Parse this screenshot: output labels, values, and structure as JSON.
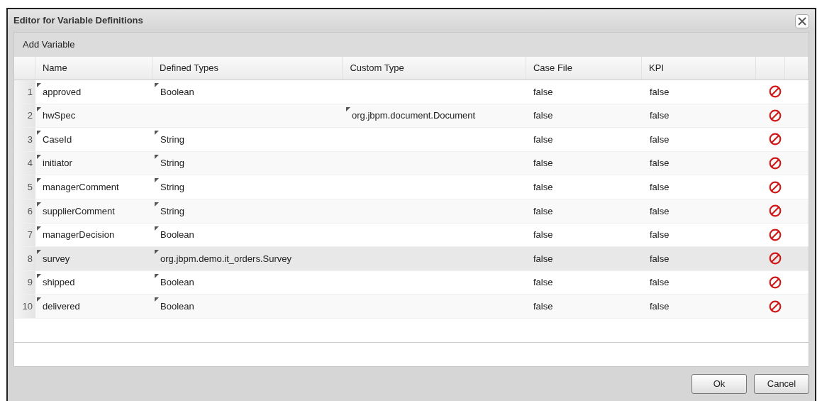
{
  "dialog": {
    "title": "Editor for Variable Definitions"
  },
  "toolbar": {
    "add_button": "Add Variable"
  },
  "table": {
    "columns": [
      "Name",
      "Defined Types",
      "Custom Type",
      "Case File",
      "KPI"
    ],
    "rows": [
      {
        "number": "1",
        "name": "approved",
        "defined_type": "Boolean",
        "custom_type": "",
        "case_file": "false",
        "kpi": "false",
        "selected": false
      },
      {
        "number": "2",
        "name": "hwSpec",
        "defined_type": "",
        "custom_type": "org.jbpm.document.Document",
        "case_file": "false",
        "kpi": "false",
        "selected": false
      },
      {
        "number": "3",
        "name": "CaseId",
        "defined_type": "String",
        "custom_type": "",
        "case_file": "false",
        "kpi": "false",
        "selected": false
      },
      {
        "number": "4",
        "name": "initiator",
        "defined_type": "String",
        "custom_type": "",
        "case_file": "false",
        "kpi": "false",
        "selected": false
      },
      {
        "number": "5",
        "name": "managerComment",
        "defined_type": "String",
        "custom_type": "",
        "case_file": "false",
        "kpi": "false",
        "selected": false
      },
      {
        "number": "6",
        "name": "supplierComment",
        "defined_type": "String",
        "custom_type": "",
        "case_file": "false",
        "kpi": "false",
        "selected": false
      },
      {
        "number": "7",
        "name": "managerDecision",
        "defined_type": "Boolean",
        "custom_type": "",
        "case_file": "false",
        "kpi": "false",
        "selected": false
      },
      {
        "number": "8",
        "name": "survey",
        "defined_type": "org.jbpm.demo.it_orders.Survey",
        "custom_type": "",
        "case_file": "false",
        "kpi": "false",
        "selected": true
      },
      {
        "number": "9",
        "name": "shipped",
        "defined_type": "Boolean",
        "custom_type": "",
        "case_file": "false",
        "kpi": "false",
        "selected": false
      },
      {
        "number": "10",
        "name": "delivered",
        "defined_type": "Boolean",
        "custom_type": "",
        "case_file": "false",
        "kpi": "false",
        "selected": false
      }
    ]
  },
  "buttons": [
    "Ok",
    "Cancel"
  ]
}
